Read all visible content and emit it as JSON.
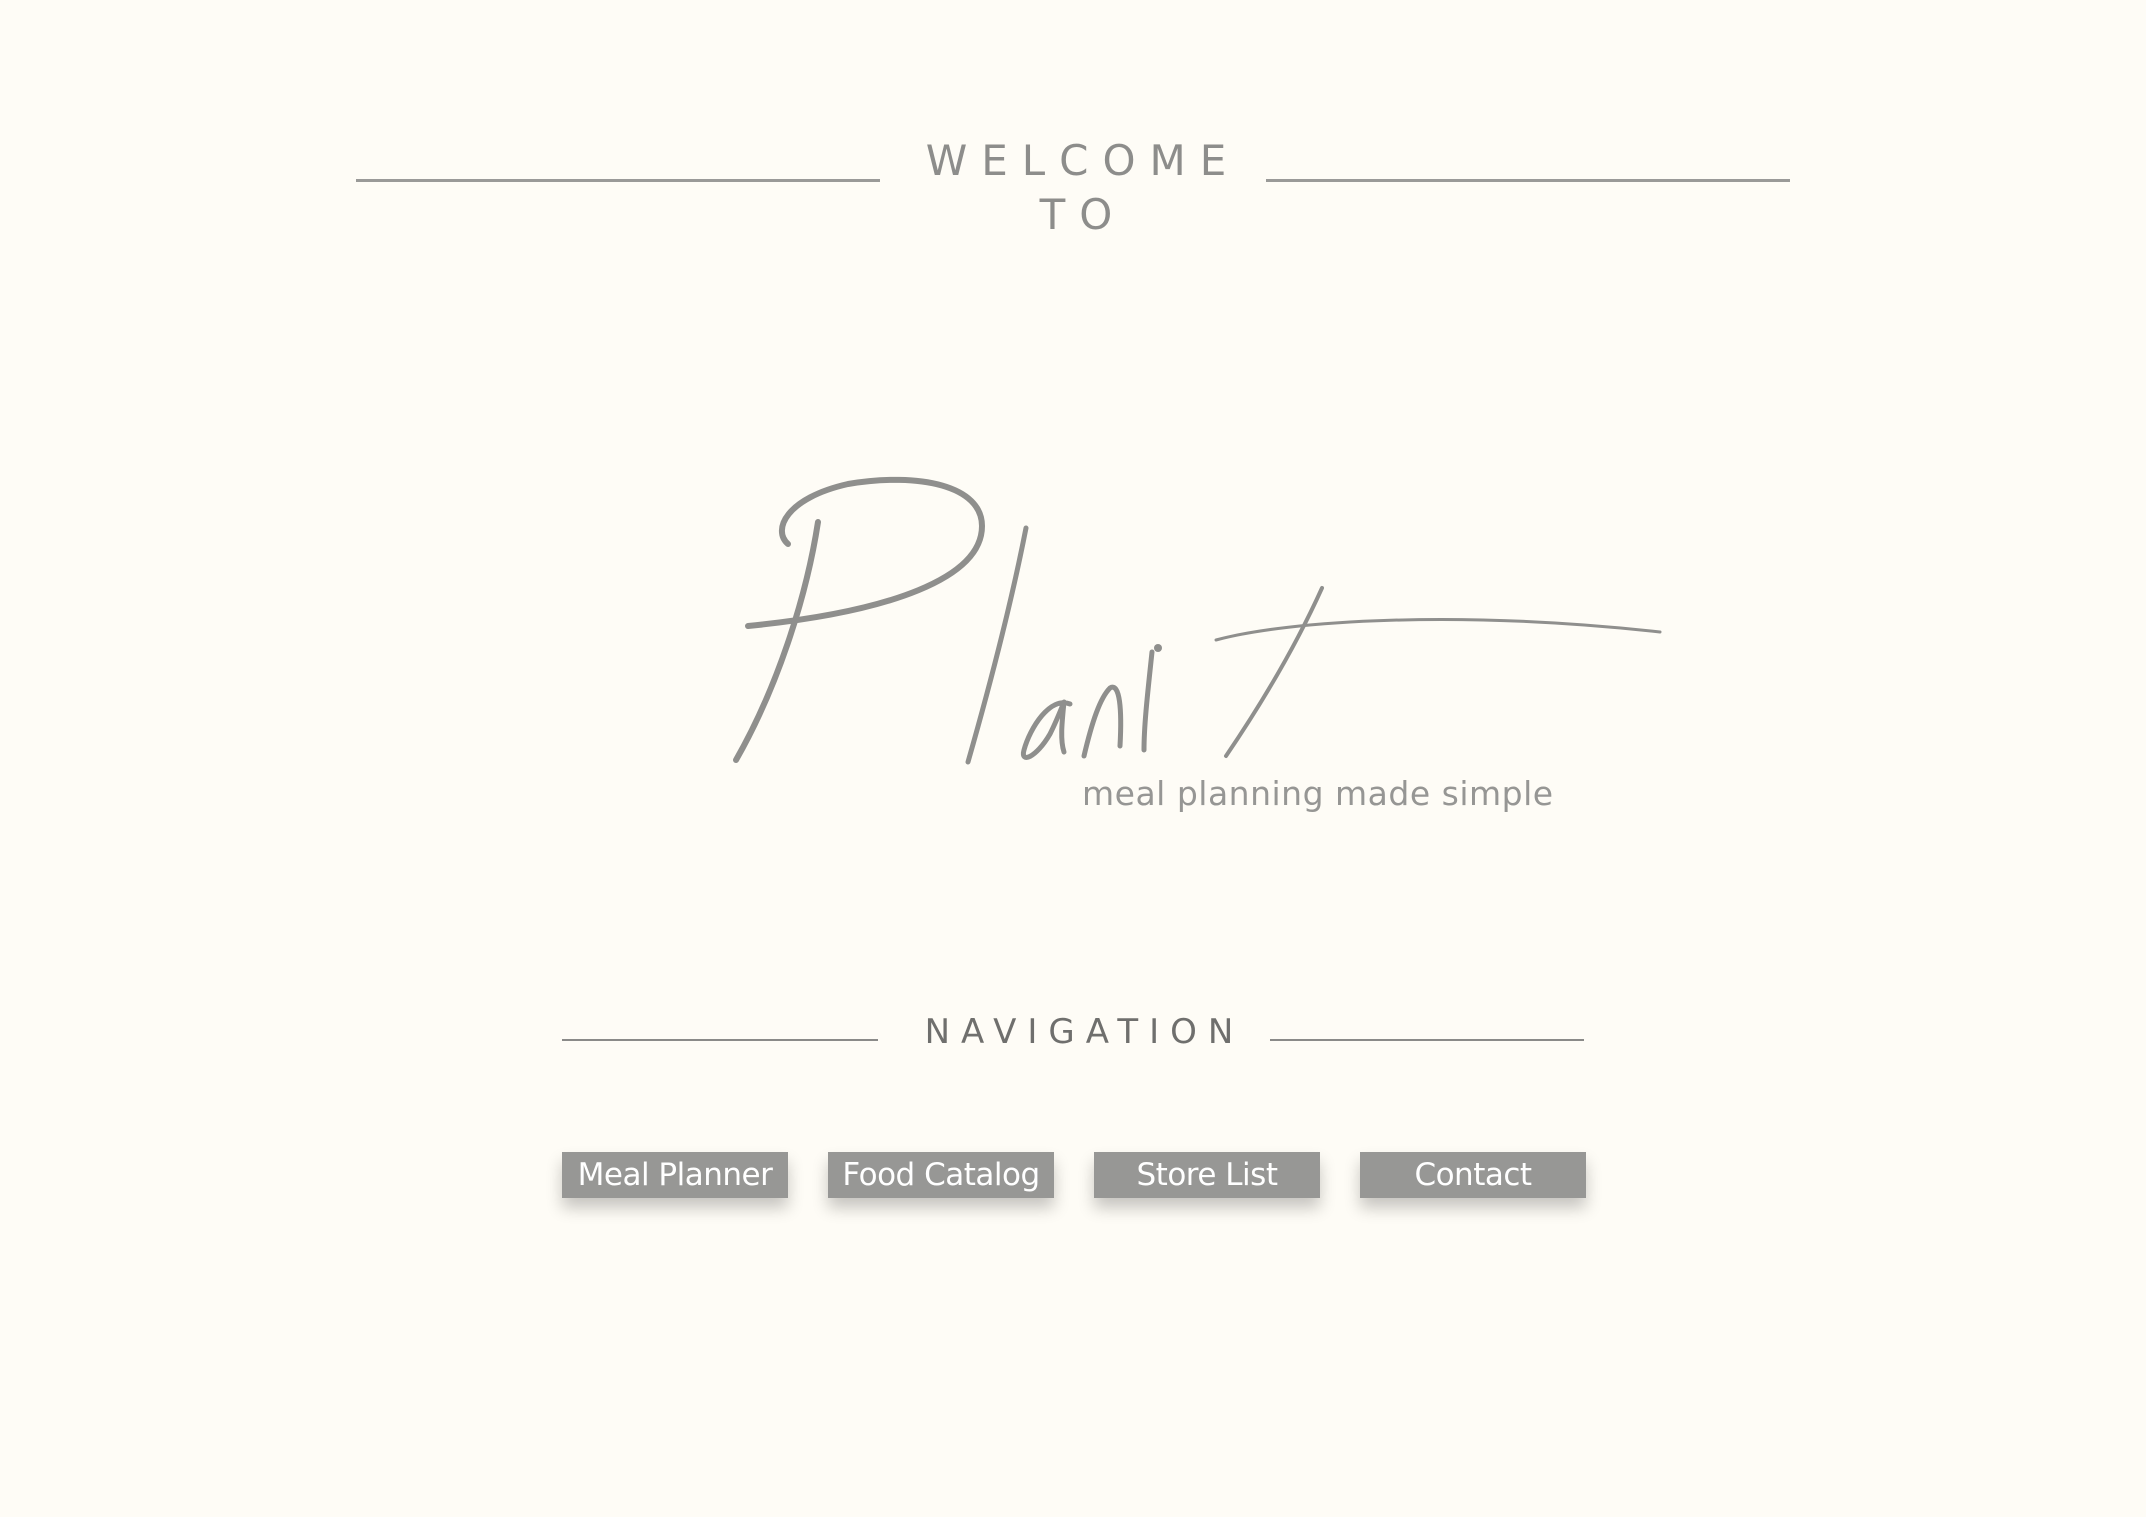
{
  "welcome": {
    "line1": "WELCOME",
    "line2": "TO"
  },
  "brand": {
    "logo_text": "Planit",
    "tagline": "meal planning made simple"
  },
  "navigation": {
    "heading": "NAVIGATION",
    "items": [
      {
        "label": "Meal Planner"
      },
      {
        "label": "Food Catalog"
      },
      {
        "label": "Store List"
      },
      {
        "label": "Contact"
      }
    ]
  },
  "colors": {
    "background": "#fefcf6",
    "ink": "#8d8d8b",
    "button": "#979795",
    "button_text": "#ffffff"
  }
}
